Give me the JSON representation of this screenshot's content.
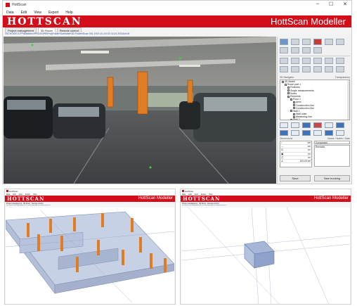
{
  "main": {
    "title": "HottScan",
    "window_controls": {
      "minimize": "–",
      "maximize": "☐",
      "close": "✕"
    },
    "menu": [
      "Data",
      "Edit",
      "View",
      "Export",
      "Help"
    ],
    "brand": "HOTTSCAN",
    "banner_title": "HottScan Modeller",
    "tabs": [
      "Project management",
      "3D Room",
      "Remote control"
    ],
    "active_tab": 1,
    "path": "\\\\SCHOSR-0-FP\\Blackbox\\PROJ\\OPB\\Proj\\Folder\\Subfolder\\3D Folder\\Scan 001 2019-10-16 02:13:24 20316v4.tif",
    "colors": {
      "brand_red": "#d40d1b",
      "column_orange": "#e07c24",
      "tool_blue": "#3d72b8"
    }
  },
  "panel": {
    "navigator_label": "3D Navigator",
    "transparency_label": "Transparency",
    "tree": [
      {
        "label": "3D Model",
        "indent": 0
      },
      {
        "label": "Room part 1",
        "indent": 1
      },
      {
        "label": "Features",
        "indent": 2
      },
      {
        "label": "Single measurements",
        "indent": 2
      },
      {
        "label": "Notes",
        "indent": 2
      },
      {
        "label": "Elements",
        "indent": 2
      },
      {
        "label": "Floor 1",
        "indent": 3
      },
      {
        "label": "Area",
        "indent": 4
      },
      {
        "label": "Construction line",
        "indent": 4
      },
      {
        "label": "Construction line",
        "indent": 4
      },
      {
        "label": "Wall 1",
        "indent": 3
      },
      {
        "label": "Wall outer",
        "indent": 4
      },
      {
        "label": "Measuring line",
        "indent": 4
      },
      {
        "label": "Wall 2",
        "indent": 3
      },
      {
        "label": "Wall inner",
        "indent": 4
      },
      {
        "label": "Door",
        "indent": 4
      },
      {
        "label": "Column 1",
        "indent": 3
      }
    ],
    "dimensions_label": "Dimensions",
    "name_label": "Name / Notes / Date",
    "props": [
      {
        "k": "↕",
        "v": "cm"
      },
      {
        "k": "↔",
        "v": "cm"
      },
      {
        "k": "⊡",
        "v": "m²"
      },
      {
        "k": "▣",
        "v": "m²"
      },
      {
        "k": "◫",
        "v": "m³"
      },
      {
        "k": "∠",
        "v": "100.00   cm"
      }
    ],
    "name_value": "Component",
    "notes_placeholder": "Remarks",
    "save_button": "Save",
    "new_booking_button": "New booking"
  },
  "thumb_left": {
    "title": "HottScan",
    "menu": [
      "Data",
      "Edit",
      "View",
      "Export",
      "Help"
    ],
    "brand": "HOTTSCAN",
    "banner_title": "HottScan Modeller",
    "tabs": [
      "Project management",
      "3D Room",
      "Remote control"
    ],
    "path": "\\\\SCHOSR-0-FP\\Blackbox\\PROJ\\OPB\\Proj\\Folder\\3D Folder\\Scan 001"
  },
  "thumb_right": {
    "title": "HottScan",
    "menu": [
      "Data",
      "Edit",
      "View",
      "Export",
      "Help"
    ],
    "brand": "HOTTSCAN",
    "banner_title": "HottScan Modeller",
    "tabs": [
      "Project management",
      "3D Room",
      "Remote control"
    ],
    "path": "\\\\SCHOSR-0-FP\\Blackbox\\PROJ\\OPB\\Proj\\Folder\\3D Folder\\Scan 001"
  }
}
